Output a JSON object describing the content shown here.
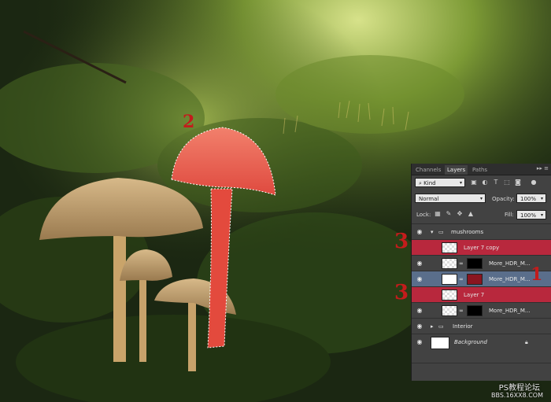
{
  "panel": {
    "tabs": [
      "Channels",
      "Layers",
      "Paths"
    ],
    "active_tab": "Layers",
    "filter_label": "Kind",
    "blend_mode": "Normal",
    "opacity_label": "Opacity:",
    "opacity_value": "100%",
    "lock_label": "Lock:",
    "fill_label": "Fill:",
    "fill_value": "100%",
    "layers": [
      {
        "name": "mushrooms",
        "type": "group",
        "expanded": true
      },
      {
        "name": "Layer 7 copy",
        "type": "layer",
        "highlight": "red"
      },
      {
        "name": "More_HDR_M...",
        "type": "adjustment"
      },
      {
        "name": "More_HDR_M...",
        "type": "adjustment",
        "selected": true
      },
      {
        "name": "Layer 7",
        "type": "layer",
        "highlight": "red"
      },
      {
        "name": "More_HDR_M...",
        "type": "adjustment"
      },
      {
        "name": "Interior",
        "type": "group",
        "expanded": false
      },
      {
        "name": "Background",
        "type": "background",
        "locked": true
      }
    ]
  },
  "annotations": {
    "mushroom": "2",
    "layer_copy": "3",
    "layer_selected": "1",
    "layer_seven": "3"
  },
  "watermark": {
    "line1": "PS教程论坛",
    "line2": "BBS.16XX8.COM"
  }
}
